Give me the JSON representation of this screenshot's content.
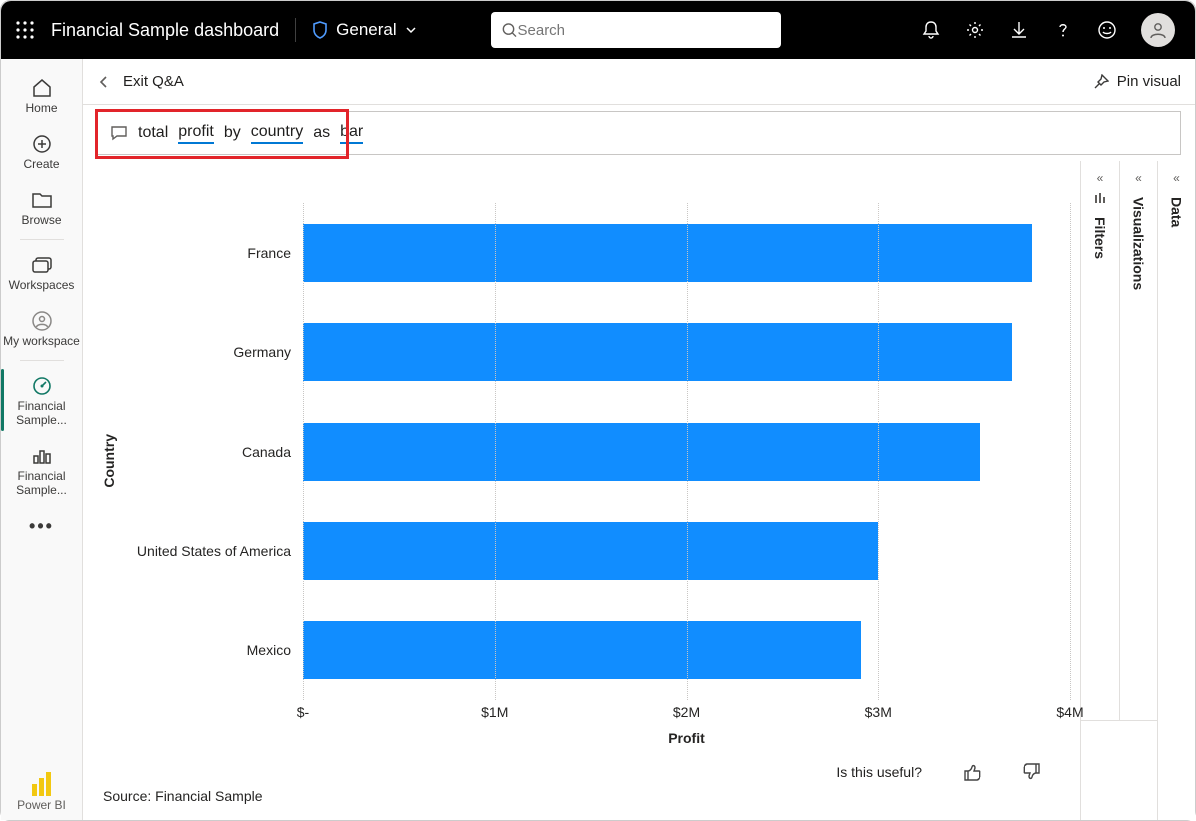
{
  "topbar": {
    "title": "Financial Sample dashboard",
    "sensitivity": "General",
    "search_placeholder": "Search"
  },
  "leftnav": {
    "home": "Home",
    "create": "Create",
    "browse": "Browse",
    "workspaces": "Workspaces",
    "my_workspace": "My workspace",
    "item_a": "Financial Sample...",
    "item_b": "Financial Sample...",
    "powerbi": "Power BI"
  },
  "subheader": {
    "exit": "Exit Q&A",
    "pin": "Pin visual"
  },
  "qna": {
    "t0": "total",
    "t1": "profit",
    "t2": "by",
    "t3": "country",
    "t4": "as",
    "t5": "bar"
  },
  "panes": {
    "filters": "Filters",
    "viz": "Visualizations",
    "data": "Data"
  },
  "feedback": {
    "prompt": "Is this useful?"
  },
  "footer": {
    "source": "Source: Financial Sample"
  },
  "chart_data": {
    "type": "bar",
    "orientation": "horizontal",
    "ylabel": "Country",
    "xlabel": "Profit",
    "xlim": [
      0,
      4000000
    ],
    "xticks": [
      0,
      1000000,
      2000000,
      3000000,
      4000000
    ],
    "xtick_labels": [
      "$-",
      "$1M",
      "$2M",
      "$3M",
      "$4M"
    ],
    "categories": [
      "France",
      "Germany",
      "Canada",
      "United States of America",
      "Mexico"
    ],
    "values": [
      3800000,
      3700000,
      3530000,
      3000000,
      2910000
    ],
    "bar_color": "#118dff"
  }
}
